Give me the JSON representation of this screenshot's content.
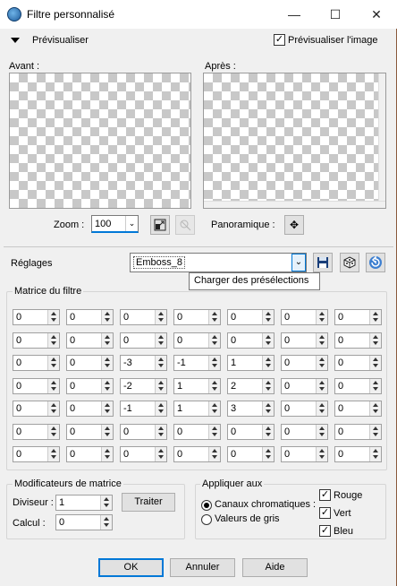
{
  "window": {
    "title": "Filtre personnalisé",
    "minimize": "—",
    "maximize": "☐",
    "close": "✕"
  },
  "preview": {
    "label": "Prévisualiser",
    "image_preview_label": "Prévisualiser l'image",
    "image_preview_checked": true,
    "before": "Avant :",
    "after": "Après :",
    "zoom_label": "Zoom :",
    "zoom_value": "100",
    "pan_label": "Panoramique :"
  },
  "presets": {
    "label": "Réglages",
    "value": "Emboss_8",
    "tooltip": "Charger des présélections"
  },
  "matrix": {
    "label": "Matrice du filtre",
    "rows": [
      [
        "0",
        "0",
        "0",
        "0",
        "0",
        "0",
        "0"
      ],
      [
        "0",
        "0",
        "0",
        "0",
        "0",
        "0",
        "0"
      ],
      [
        "0",
        "0",
        "-3",
        "-1",
        "1",
        "0",
        "0"
      ],
      [
        "0",
        "0",
        "-2",
        "1",
        "2",
        "0",
        "0"
      ],
      [
        "0",
        "0",
        "-1",
        "1",
        "3",
        "0",
        "0"
      ],
      [
        "0",
        "0",
        "0",
        "0",
        "0",
        "0",
        "0"
      ],
      [
        "0",
        "0",
        "0",
        "0",
        "0",
        "0",
        "0"
      ]
    ]
  },
  "modifiers": {
    "label": "Modificateurs de matrice",
    "divisor_label": "Diviseur :",
    "divisor": "1",
    "bias_label": "Calcul :",
    "bias": "0",
    "process_button": "Traiter"
  },
  "apply": {
    "label": "Appliquer aux",
    "color_channels": "Canaux chromatiques :",
    "grey_values": "Valeurs de gris",
    "selected": "color_channels",
    "red": "Rouge",
    "green": "Vert",
    "blue": "Bleu",
    "red_checked": true,
    "green_checked": true,
    "blue_checked": true
  },
  "buttons": {
    "ok": "OK",
    "cancel": "Annuler",
    "help": "Aide"
  },
  "colors": {
    "accent": "#0078d7",
    "check_bg": "#c8c8c8"
  }
}
